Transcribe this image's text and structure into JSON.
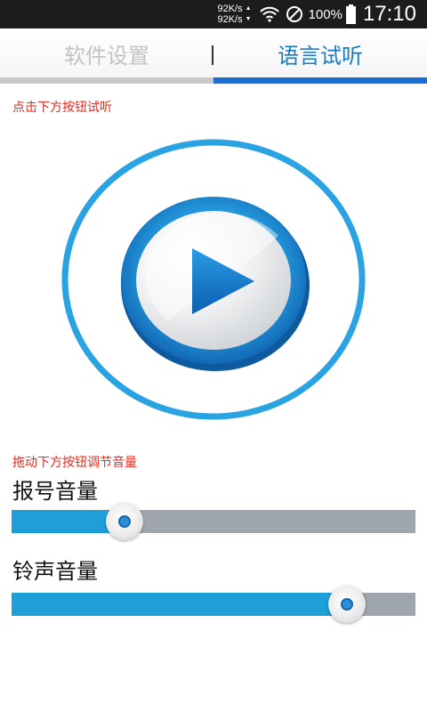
{
  "status_bar": {
    "up_speed": "92K/s",
    "down_speed": "92K/s",
    "battery": "100%",
    "time": "17:10"
  },
  "tabs": [
    {
      "label": "软件设置",
      "active": false
    },
    {
      "label": "语言试听",
      "active": true
    }
  ],
  "hint_play": "点击下方按钮试听",
  "hint_volume": "拖动下方按钮调节音量",
  "volumes": [
    {
      "label": "报号音量",
      "level": 0.28
    },
    {
      "label": "铃声音量",
      "level": 0.83
    }
  ],
  "colors": {
    "accent": "#1b6fd2",
    "hint": "#e8291d",
    "slider_fill": "#1e9fd8",
    "slider_track": "#9fa5ac"
  },
  "icons": [
    "wifi-icon",
    "no-sim-icon",
    "battery-icon",
    "play-icon"
  ]
}
